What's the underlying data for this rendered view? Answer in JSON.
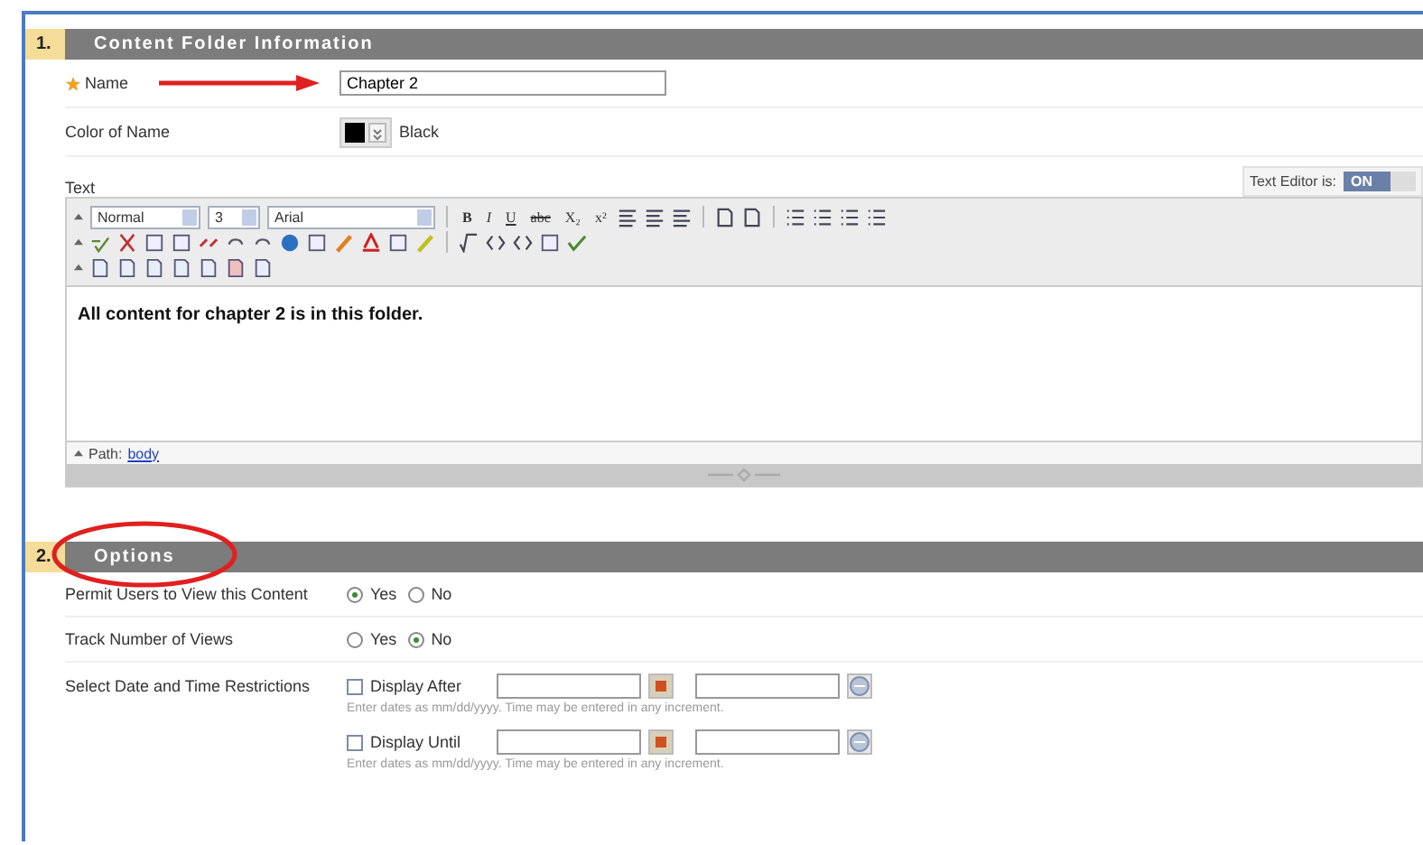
{
  "section_1": {
    "number": "1.",
    "title": "Content Folder Information"
  },
  "name_field": {
    "label": "Name",
    "required": true,
    "value": "Chapter 2"
  },
  "color_field": {
    "label": "Color of Name",
    "value": "Black"
  },
  "text_editor": {
    "label": "Text",
    "toggle_label": "Text Editor is:",
    "toggle_on": true,
    "toggle_text": "ON",
    "paragraph_style": "Normal",
    "font_size": "3",
    "font_family": "Arial",
    "format_buttons": [
      "B",
      "I",
      "U",
      "abc",
      "X₂",
      "x²"
    ],
    "content": "All content for chapter 2 is in this folder.",
    "path_label": "Path:",
    "path_link": "body"
  },
  "section_2": {
    "number": "2.",
    "title": "Options"
  },
  "options": [
    {
      "label": "Permit Users to View this Content",
      "kind": "radio",
      "choices": [
        {
          "label": "Yes",
          "selected": true
        },
        {
          "label": "No",
          "selected": false
        }
      ]
    },
    {
      "label": "Track Number of Views",
      "kind": "radio",
      "choices": [
        {
          "label": "Yes",
          "selected": false
        },
        {
          "label": "No",
          "selected": true
        }
      ]
    },
    {
      "label": "Select Date and Time Restrictions",
      "kind": "dates",
      "restrictions": [
        {
          "label": "Display After",
          "checked": false,
          "hint": "Enter dates as mm/dd/yyyy. Time may be entered in any increment."
        },
        {
          "label": "Display Until",
          "checked": false,
          "hint": "Enter dates as mm/dd/yyyy. Time may be entered in any increment."
        }
      ]
    }
  ]
}
